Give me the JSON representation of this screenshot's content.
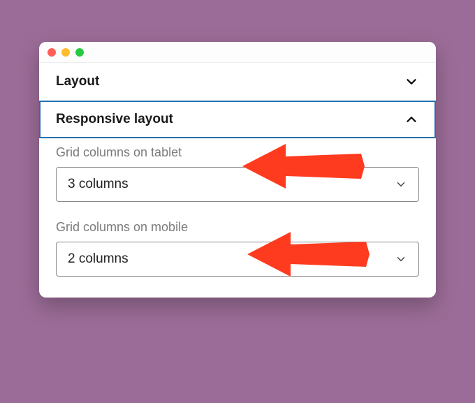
{
  "sections": {
    "layout": {
      "title": "Layout",
      "expanded": false
    },
    "responsive": {
      "title": "Responsive layout",
      "expanded": true
    }
  },
  "fields": {
    "tablet": {
      "label": "Grid columns on tablet",
      "value": "3 columns"
    },
    "mobile": {
      "label": "Grid columns on mobile",
      "value": "2 columns"
    }
  },
  "annotation_color": "#ff3b1f"
}
